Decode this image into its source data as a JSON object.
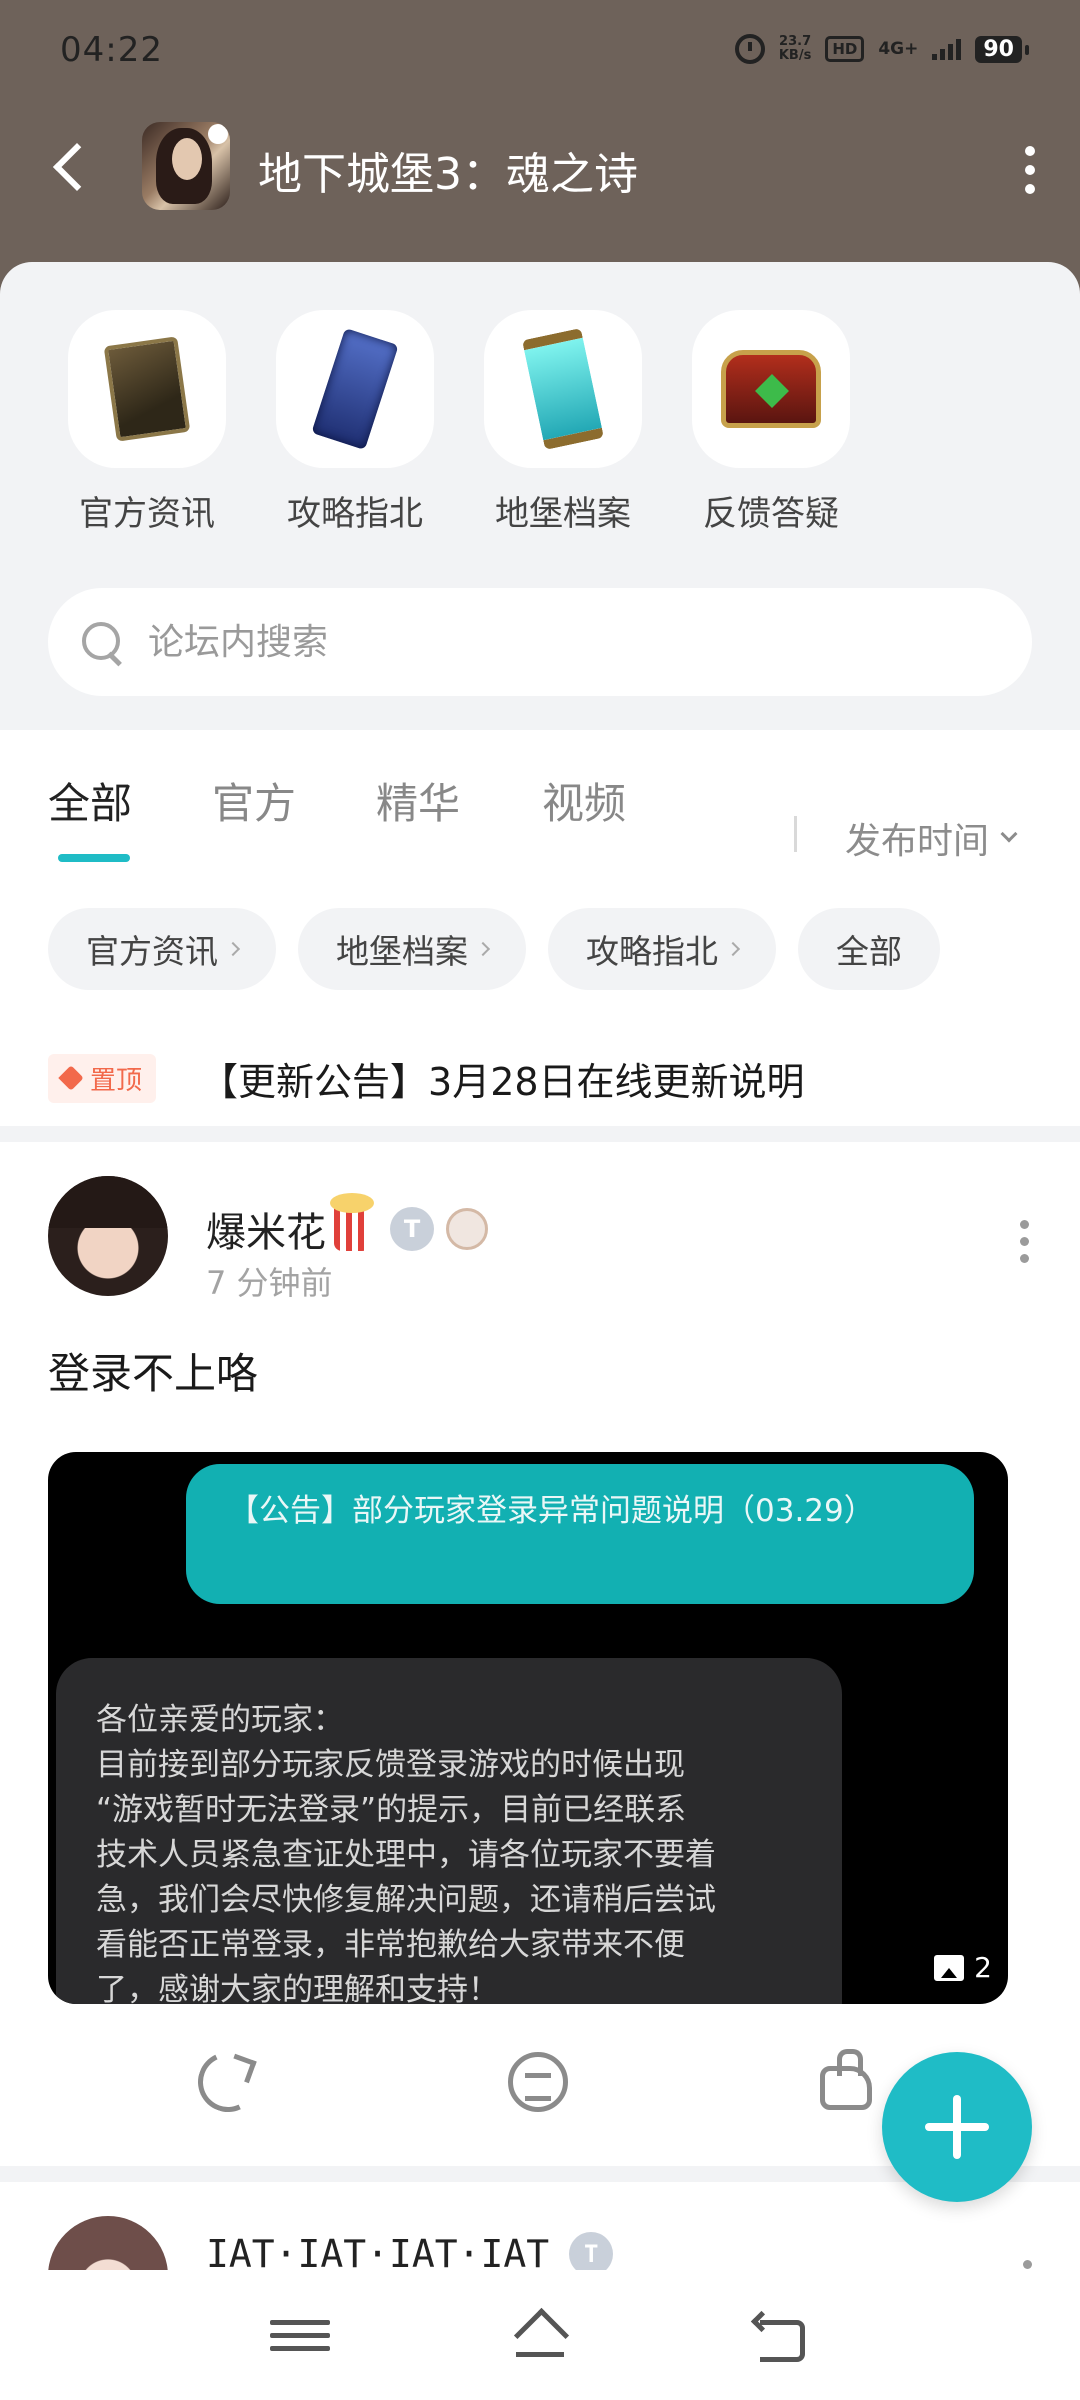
{
  "status_bar": {
    "time": "04:22",
    "net_speed_value": "23.7",
    "net_speed_unit": "KB/s",
    "hd": "HD",
    "network": "4G+",
    "battery": "90",
    "icons": [
      "alarm-icon",
      "signal-icon",
      "battery-icon"
    ]
  },
  "header": {
    "title": "地下城堡3：魂之诗",
    "background_color": "#6e625a"
  },
  "quick_entries": [
    {
      "label": "官方资讯",
      "icon": "book-icon"
    },
    {
      "label": "攻略指北",
      "icon": "blue-scroll-icon"
    },
    {
      "label": "地堡档案",
      "icon": "cyan-scroll-icon"
    },
    {
      "label": "反馈答疑",
      "icon": "chest-icon"
    }
  ],
  "search": {
    "placeholder": "论坛内搜索"
  },
  "tabs": [
    {
      "label": "全部",
      "active": true
    },
    {
      "label": "官方",
      "active": false
    },
    {
      "label": "精华",
      "active": false
    },
    {
      "label": "视频",
      "active": false
    }
  ],
  "sort": {
    "label": "发布时间"
  },
  "chips": [
    {
      "label": "官方资讯",
      "arrow": true
    },
    {
      "label": "地堡档案",
      "arrow": true
    },
    {
      "label": "攻略指北",
      "arrow": true
    },
    {
      "label": "全部",
      "arrow": false
    }
  ],
  "pinned": {
    "badge": "置顶",
    "title": "【更新公告】3月28日在线更新说明"
  },
  "post": {
    "username": "爆米花",
    "level_badge": "T",
    "time": "7 分钟前",
    "text": "登录不上咯",
    "image": {
      "notice_title": "【公告】部分玩家登录异常问题说明（03.29）",
      "body_lines": [
        "各位亲爱的玩家：",
        "目前接到部分玩家反馈登录游戏的时候出现",
        "“游戏暂时无法登录”的提示，目前已经联系",
        "技术人员紧急查证处理中，请各位玩家不要着",
        "急，我们会尽快修复解决问题，还请稍后尝试",
        "看能否正常登录，非常抱歉给大家带来不便",
        "了，感谢大家的理解和支持！"
      ],
      "count": "2"
    }
  },
  "post2": {
    "username": "ΙΑΤ·ΙΑΤ·ΙΑΤ·ΙΑΤ",
    "level_badge": "T"
  },
  "accent_color": "#1fbcc6"
}
